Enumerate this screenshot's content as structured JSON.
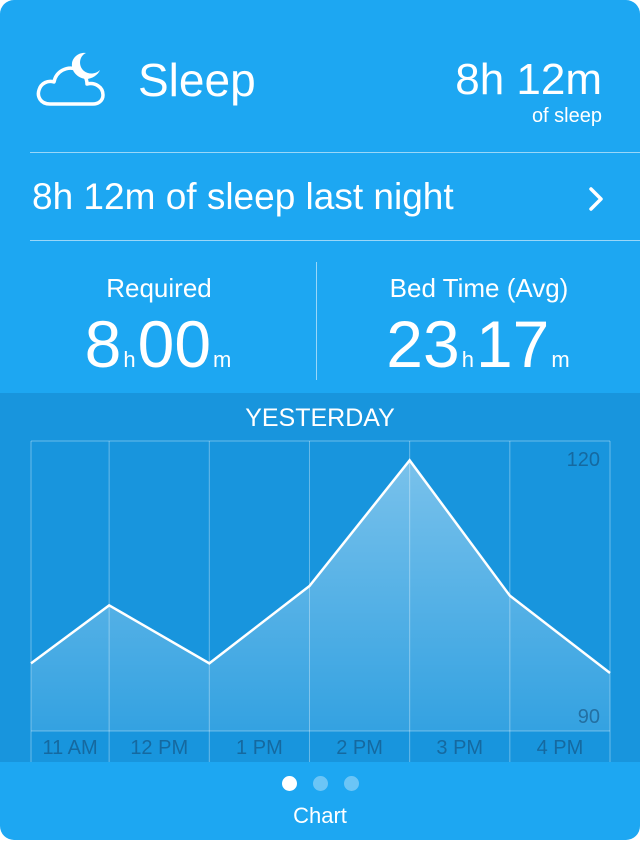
{
  "header": {
    "icon": "cloud-moon-icon",
    "title": "Sleep",
    "total_value": "8h 12m",
    "total_sub": "of sleep"
  },
  "summary": {
    "text": "8h 12m of sleep last night",
    "icon": "chevron-right-icon"
  },
  "stats": {
    "required": {
      "label": "Required",
      "hours": "8",
      "hours_unit": "h",
      "minutes": "00",
      "minutes_unit": "m"
    },
    "bedtime": {
      "label": "Bed Time (Avg)",
      "hours": "23",
      "hours_unit": "h",
      "minutes": "17",
      "minutes_unit": "m"
    }
  },
  "chart_data": {
    "type": "area",
    "title": "YESTERDAY",
    "categories": [
      "11 AM",
      "12 PM",
      "1 PM",
      "2 PM",
      "3 PM",
      "4 PM"
    ],
    "x": [
      0,
      0.78,
      1.78,
      2.78,
      3.78,
      4.78,
      5.78
    ],
    "y": [
      97,
      103,
      97,
      105,
      118,
      104,
      96
    ],
    "ylim": [
      90,
      120
    ],
    "y_tick_labels": [
      "120",
      "90"
    ],
    "grid": true
  },
  "pager": {
    "label": "Chart",
    "page_count": 3,
    "active_index": 0
  },
  "colors": {
    "background": "#1da7f2",
    "chart_panel": "#1895dd",
    "text": "#ffffff"
  }
}
